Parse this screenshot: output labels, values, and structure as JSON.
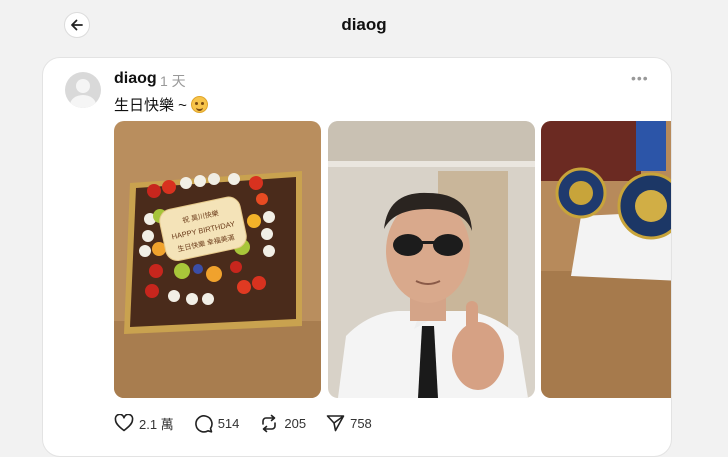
{
  "header": {
    "title": "diaog"
  },
  "post": {
    "username": "diaog",
    "time": "1 天",
    "caption": "生日快樂 ~",
    "caption_emoji": "smiling-face-icon",
    "cake_text": {
      "line1": "祝 昊川快樂",
      "line2": "HAPPY BIRTHDAY",
      "line3": "生日快樂 幸福美滿"
    },
    "actions": {
      "likes": "2.1 萬",
      "comments": "514",
      "reposts": "205",
      "shares": "758"
    }
  },
  "icons": {
    "back": "back-arrow-icon",
    "more": "more-icon",
    "like": "heart-icon",
    "comment": "comment-icon",
    "repost": "repost-icon",
    "share": "send-icon"
  }
}
